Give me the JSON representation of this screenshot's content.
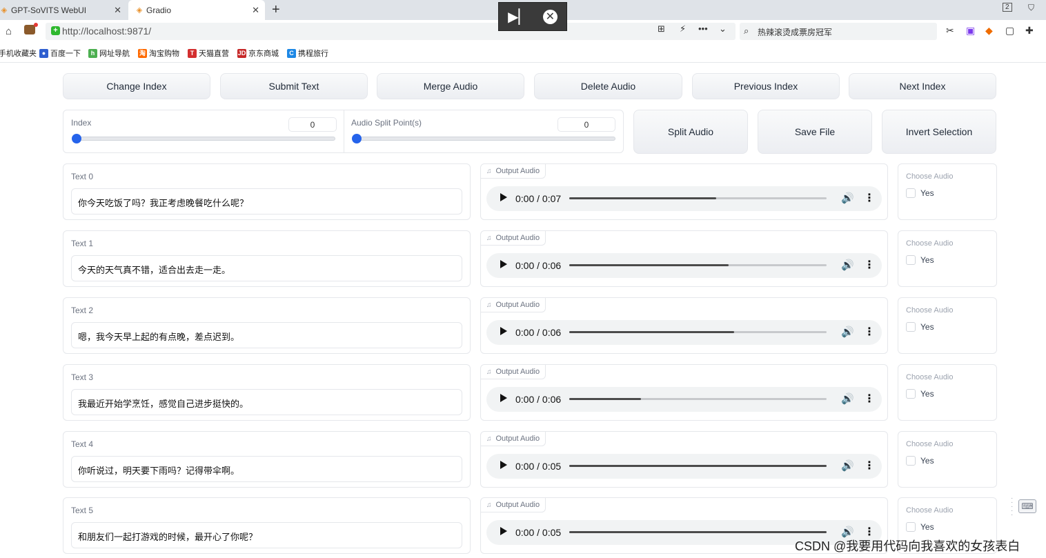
{
  "browser": {
    "tabs": [
      {
        "label": "GPT-SoVITS WebUI",
        "close": "✕"
      },
      {
        "label": "Gradio",
        "close": "✕"
      }
    ],
    "new_tab": "+",
    "window_badge": "2",
    "url": "http://localhost:9871/",
    "search_text": "热辣滚烫成票房冠军",
    "bookmarks": [
      "手机收藏夹",
      "百度一下",
      "网址导航",
      "淘宝购物",
      "天猫直营",
      "京东商城",
      "携程旅行"
    ]
  },
  "toolbar": {
    "change_index": "Change Index",
    "submit_text": "Submit Text",
    "merge_audio": "Merge Audio",
    "delete_audio": "Delete Audio",
    "previous_index": "Previous Index",
    "next_index": "Next Index"
  },
  "controls": {
    "index_label": "Index",
    "index_value": "0",
    "split_label": "Audio Split Point(s)",
    "split_value": "0",
    "split_audio": "Split Audio",
    "save_file": "Save File",
    "invert_selection": "Invert Selection"
  },
  "rows": [
    {
      "text_label": "Text 0",
      "text": "你今天吃饭了吗？我正考虑晚餐吃什么呢？",
      "audio_label": "Output Audio",
      "time": "0:00 / 0:07",
      "progress": 0.57,
      "choose_label": "Choose Audio",
      "choose_option": "Yes"
    },
    {
      "text_label": "Text 1",
      "text": "今天的天气真不错，适合出去走一走。",
      "audio_label": "Output Audio",
      "time": "0:00 / 0:06",
      "progress": 0.62,
      "choose_label": "Choose Audio",
      "choose_option": "Yes"
    },
    {
      "text_label": "Text 2",
      "text": "嗯，我今天早上起的有点晚，差点迟到。",
      "audio_label": "Output Audio",
      "time": "0:00 / 0:06",
      "progress": 0.64,
      "choose_label": "Choose Audio",
      "choose_option": "Yes"
    },
    {
      "text_label": "Text 3",
      "text": "我最近开始学烹饪，感觉自己进步挺快的。",
      "audio_label": "Output Audio",
      "time": "0:00 / 0:06",
      "progress": 0.28,
      "choose_label": "Choose Audio",
      "choose_option": "Yes"
    },
    {
      "text_label": "Text 4",
      "text": "你听说过，明天要下雨吗？记得带伞啊。",
      "audio_label": "Output Audio",
      "time": "0:00 / 0:05",
      "progress": 1.0,
      "choose_label": "Choose Audio",
      "choose_option": "Yes"
    },
    {
      "text_label": "Text 5",
      "text": "和朋友们一起打游戏的时候，最开心了你呢？",
      "audio_label": "Output Audio",
      "time": "0:00 / 0:05",
      "progress": 1.0,
      "choose_label": "Choose Audio",
      "choose_option": "Yes"
    }
  ],
  "watermark": "CSDN @我要用代码向我喜欢的女孩表白"
}
